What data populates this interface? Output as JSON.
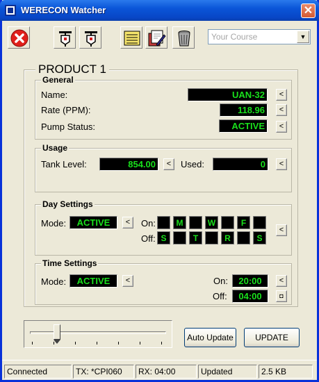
{
  "window": {
    "title": "WERECON Watcher"
  },
  "toolbar": {
    "course_placeholder": "Your Course",
    "icons": [
      "stop-icon",
      "pump-icon",
      "pump-icon-2",
      "notes-icon",
      "edit-icon",
      "trash-icon"
    ]
  },
  "product": {
    "title": "PRODUCT 1",
    "general": {
      "title": "General",
      "name_label": "Name:",
      "name_value": "UAN-32",
      "rate_label": "Rate (PPM):",
      "rate_value": "118.96",
      "status_label": "Pump Status:",
      "status_value": "ACTIVE"
    },
    "usage": {
      "title": "Usage",
      "tank_label": "Tank Level:",
      "tank_value": "854.00",
      "used_label": "Used:",
      "used_value": "0"
    },
    "day_settings": {
      "title": "Day Settings",
      "mode_label": "Mode:",
      "mode_value": "ACTIVE",
      "on_label": "On:",
      "off_label": "Off:",
      "on_days": [
        "",
        "M",
        "",
        "W",
        "",
        "F",
        ""
      ],
      "off_days": [
        "S",
        "",
        "T",
        "",
        "R",
        "",
        "S"
      ]
    },
    "time_settings": {
      "title": "Time Settings",
      "mode_label": "Mode:",
      "mode_value": "ACTIVE",
      "on_label": "On:",
      "on_value": "20:00",
      "off_label": "Off:",
      "off_value": "04:00"
    },
    "arrow_glyph": "<"
  },
  "controls": {
    "slider_value_fraction": 0.2,
    "auto_update_label": "Auto Update",
    "update_label": "UPDATE"
  },
  "statusbar": {
    "connection": "Connected",
    "tx": "TX: *CPI060",
    "rx": "RX: 04:00",
    "state": "Updated",
    "size": "2.5 KB"
  },
  "colors": {
    "lcd_text": "#19e01c",
    "lcd_bg": "#000000",
    "title_bar": "#0a55d8"
  }
}
